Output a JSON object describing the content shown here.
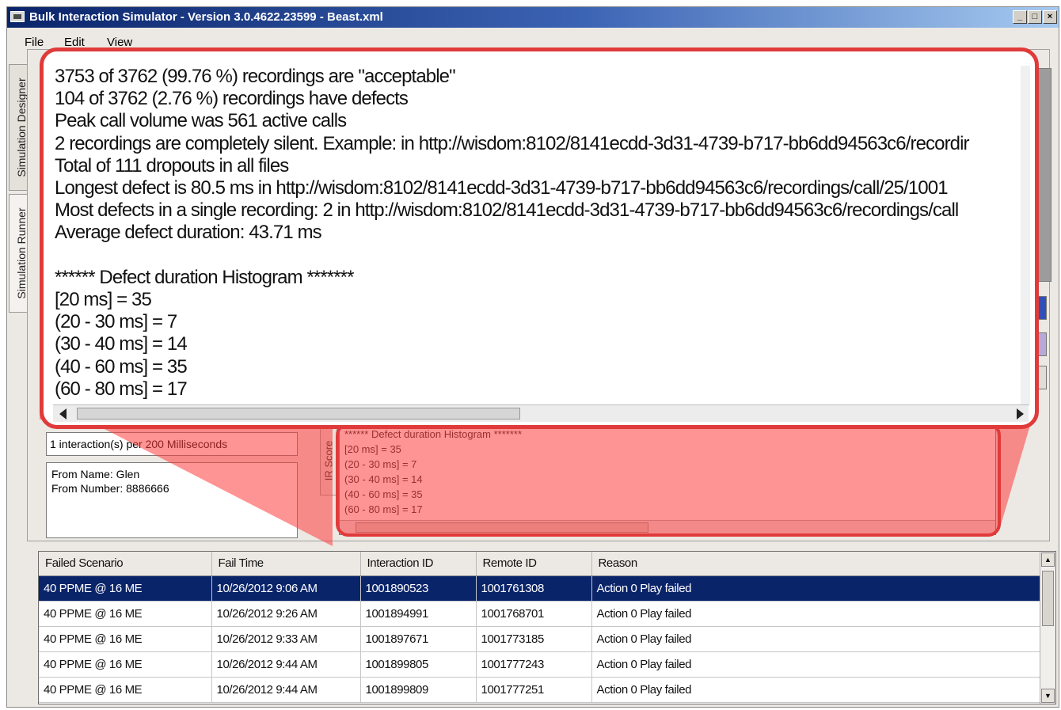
{
  "window": {
    "title": "Bulk Interaction Simulator - Version 3.0.4622.23599 - Beast.xml",
    "minimize_glyph": "_",
    "maximize_glyph": "□",
    "close_glyph": "×"
  },
  "menu": {
    "file": "File",
    "edit": "Edit",
    "view": "View"
  },
  "side_tabs": {
    "designer": "Simulation Designer",
    "runner": "Simulation Runner"
  },
  "rate": "1 interaction(s) per 200 Milliseconds",
  "from": {
    "name_line": "From Name: Glen",
    "number_line": "From Number: 8886666"
  },
  "ir_tab": "IR Score",
  "mini_report": [
    "****** Defect duration Histogram *******",
    "[20 ms] = 35",
    "(20 - 30 ms] = 7",
    "(30 - 40 ms] = 14",
    "(40 - 60 ms] = 35",
    "(60 - 80 ms] = 17"
  ],
  "report_lines": [
    "3753 of 3762 (99.76 %) recordings are \"acceptable\"",
    "104 of 3762 (2.76 %) recordings have defects",
    "Peak call volume was 561 active calls",
    "2 recordings are completely silent. Example: in http://wisdom:8102/8141ecdd-3d31-4739-b717-bb6dd94563c6/recordir",
    "Total of 111 dropouts in all files",
    "Longest defect is 80.5 ms in http://wisdom:8102/8141ecdd-3d31-4739-b717-bb6dd94563c6/recordings/call/25/1001",
    "Most defects in a single recording: 2 in http://wisdom:8102/8141ecdd-3d31-4739-b717-bb6dd94563c6/recordings/call",
    "Average defect duration: 43.71 ms",
    "",
    "****** Defect duration Histogram *******",
    "[20 ms] = 35",
    "(20 - 30 ms] = 7",
    "(30 - 40 ms] = 14",
    "(40 - 60 ms] = 35",
    "(60 - 80 ms] = 17"
  ],
  "failures": {
    "columns": [
      "Failed Scenario",
      "Fail Time",
      "Interaction ID",
      "Remote ID",
      "Reason"
    ],
    "rows": [
      {
        "scenario": "40 PPME @ 16 ME",
        "time": "10/26/2012 9:06 AM",
        "interaction_id": "1001890523",
        "remote_id": "1001761308",
        "reason": "Action 0 Play failed",
        "selected": true
      },
      {
        "scenario": "40 PPME @ 16 ME",
        "time": "10/26/2012 9:26 AM",
        "interaction_id": "1001894991",
        "remote_id": "1001768701",
        "reason": "Action 0 Play failed",
        "selected": false
      },
      {
        "scenario": "40 PPME @ 16 ME",
        "time": "10/26/2012 9:33 AM",
        "interaction_id": "1001897671",
        "remote_id": "1001773185",
        "reason": "Action 0 Play failed",
        "selected": false
      },
      {
        "scenario": "40 PPME @ 16 ME",
        "time": "10/26/2012 9:44 AM",
        "interaction_id": "1001899805",
        "remote_id": "1001777243",
        "reason": "Action 0 Play failed",
        "selected": false
      },
      {
        "scenario": "40 PPME @ 16 ME",
        "time": "10/26/2012 9:44 AM",
        "interaction_id": "1001899809",
        "remote_id": "1001777251",
        "reason": "Action 0 Play failed",
        "selected": false
      }
    ]
  },
  "colors": {
    "selection": "#0a246a",
    "highlight_red": "#e03a3a",
    "highlight_fill": "rgba(255, 60, 60, 0.55)"
  },
  "icons": {
    "app": "application-icon",
    "scroll_left": "arrow-left-icon",
    "scroll_right": "arrow-right-icon",
    "scroll_up": "arrow-up-icon",
    "scroll_down": "arrow-down-icon"
  }
}
